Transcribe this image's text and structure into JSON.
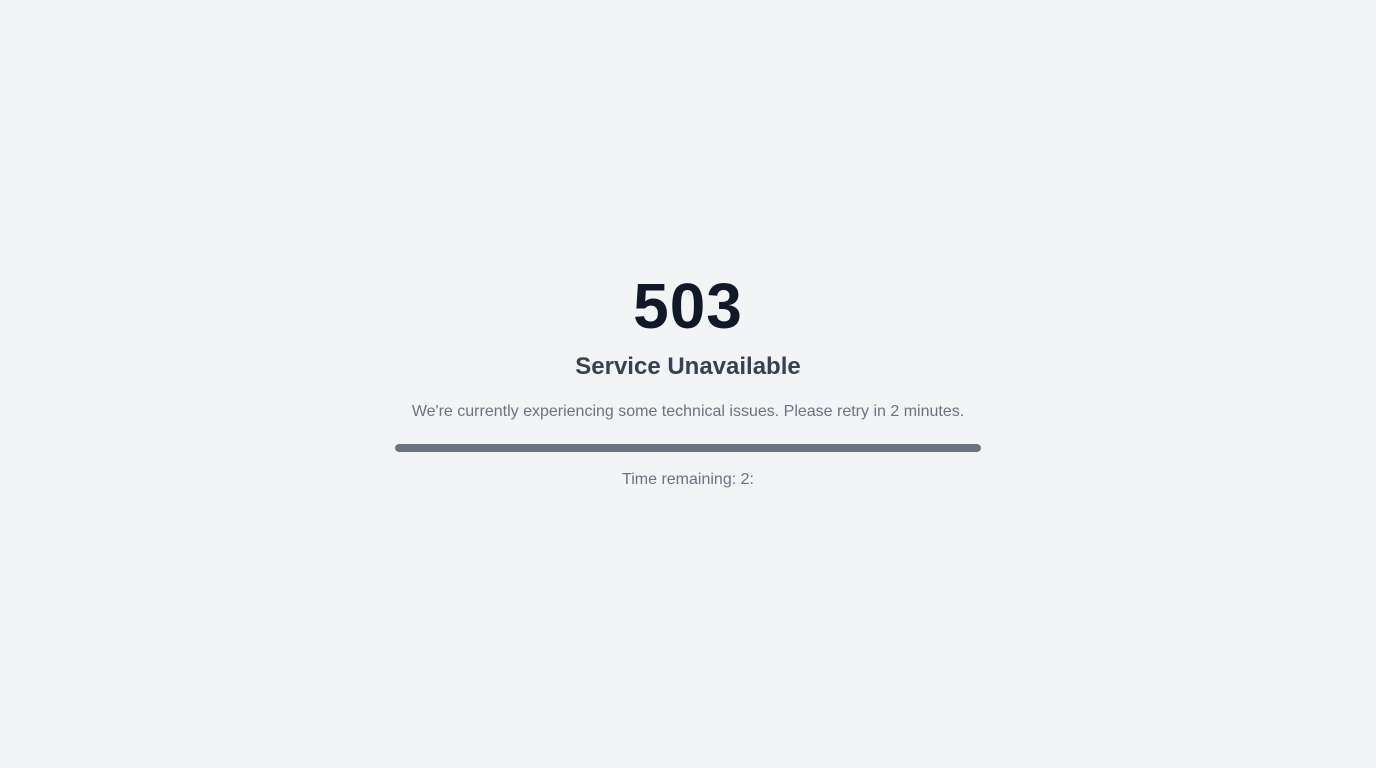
{
  "error": {
    "code": "503",
    "title": "Service Unavailable",
    "message": "We're currently experiencing some technical issues. Please retry in 2 minutes."
  },
  "progress": {
    "fraction": 1.0,
    "fill_color": "#6b7280",
    "track_color": "#e5e7eb"
  },
  "timer": {
    "text": "Time remaining: 2:"
  },
  "colors": {
    "background": "#f3f4f6",
    "code": "#111827",
    "title": "#374151",
    "muted": "#6b7280"
  }
}
